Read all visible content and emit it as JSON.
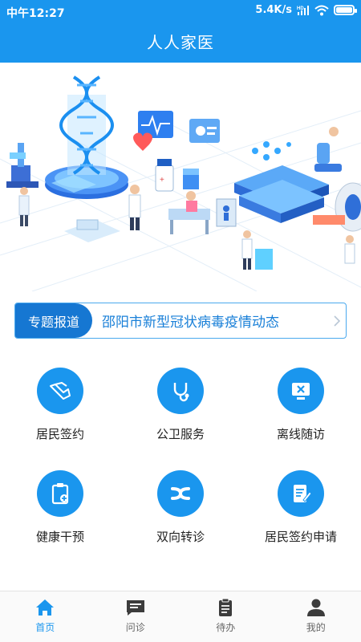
{
  "status_bar": {
    "time": "中午12:27",
    "speed": "5.4K/s",
    "battery_level": 0.9
  },
  "header": {
    "title": "人人家医"
  },
  "topic": {
    "tag": "专题报道",
    "text": "邵阳市新型冠状病毒疫情动态"
  },
  "services": [
    {
      "label": "居民签约",
      "icon": "handshake-icon"
    },
    {
      "label": "公卫服务",
      "icon": "stethoscope-icon"
    },
    {
      "label": "离线随访",
      "icon": "offline-monitor-icon"
    },
    {
      "label": "健康干预",
      "icon": "clipboard-plus-icon"
    },
    {
      "label": "双向转诊",
      "icon": "referral-icon"
    },
    {
      "label": "居民签约申请",
      "icon": "sign-document-icon"
    }
  ],
  "tabs": [
    {
      "label": "首页",
      "icon": "home-icon",
      "active": true
    },
    {
      "label": "问诊",
      "icon": "chat-icon",
      "active": false
    },
    {
      "label": "待办",
      "icon": "todo-clipboard-icon",
      "active": false
    },
    {
      "label": "我的",
      "icon": "user-icon",
      "active": false
    }
  ],
  "colors": {
    "primary": "#1a96ee",
    "topic_tag": "#1677d2",
    "topic_text": "#1a80d8"
  }
}
